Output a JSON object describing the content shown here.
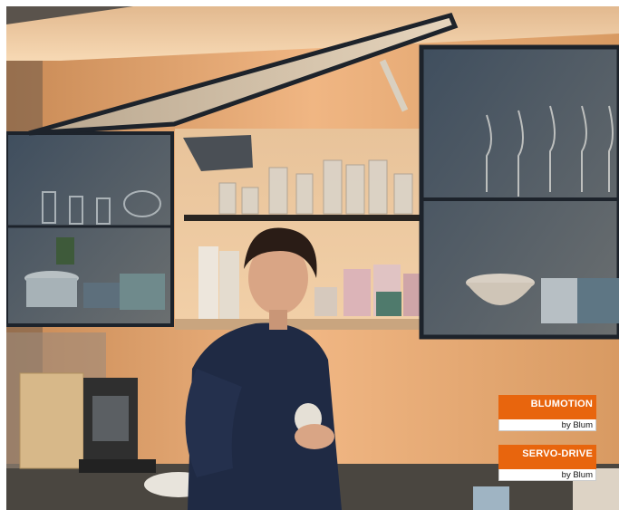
{
  "photo": {
    "subject": "woman holding mug in kitchen with lift-up wall cabinet"
  },
  "badges": [
    {
      "title": "BLUMOTION",
      "subtitle": "by Blum"
    },
    {
      "title": "SERVO-DRIVE",
      "subtitle": "by Blum"
    }
  ],
  "colors": {
    "accent_orange": "#e8650d",
    "wood": "#d9a06a",
    "cabinet_frame": "#1f2a38"
  }
}
